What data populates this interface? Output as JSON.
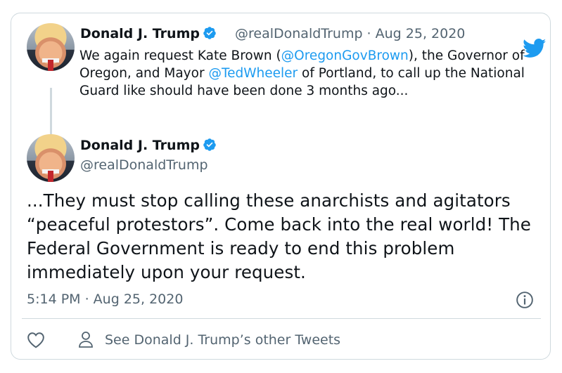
{
  "quoted_tweet": {
    "author_name": "Donald J. Trump",
    "handle_and_date": "@realDonaldTrump · Aug 25, 2020",
    "text_parts": [
      "We again request Kate Brown (",
      "@OregonGovBrown",
      "), the Governor of Oregon, and Mayor ",
      "@TedWheeler",
      " of Portland, to call up the National Guard like should have been done 3 months ago..."
    ]
  },
  "main_tweet": {
    "author_name": "Donald J. Trump",
    "handle": "@realDonaldTrump",
    "text": "...They must stop calling these anarchists and agitators “peaceful protestors”. Come back into the real world! The Federal Government is ready to end this problem immediately upon your request.",
    "timestamp": "5:14 PM · Aug 25, 2020"
  },
  "footer": {
    "other_tweets_label": "See Donald J. Trump’s other Tweets"
  },
  "colors": {
    "link": "#1d9bf0",
    "verified": "#1d9bf0",
    "secondary_text": "#536471",
    "border": "#cfd9de"
  },
  "icons": [
    "verified-badge-icon",
    "twitter-bird-icon",
    "info-icon",
    "heart-icon",
    "person-icon"
  ]
}
